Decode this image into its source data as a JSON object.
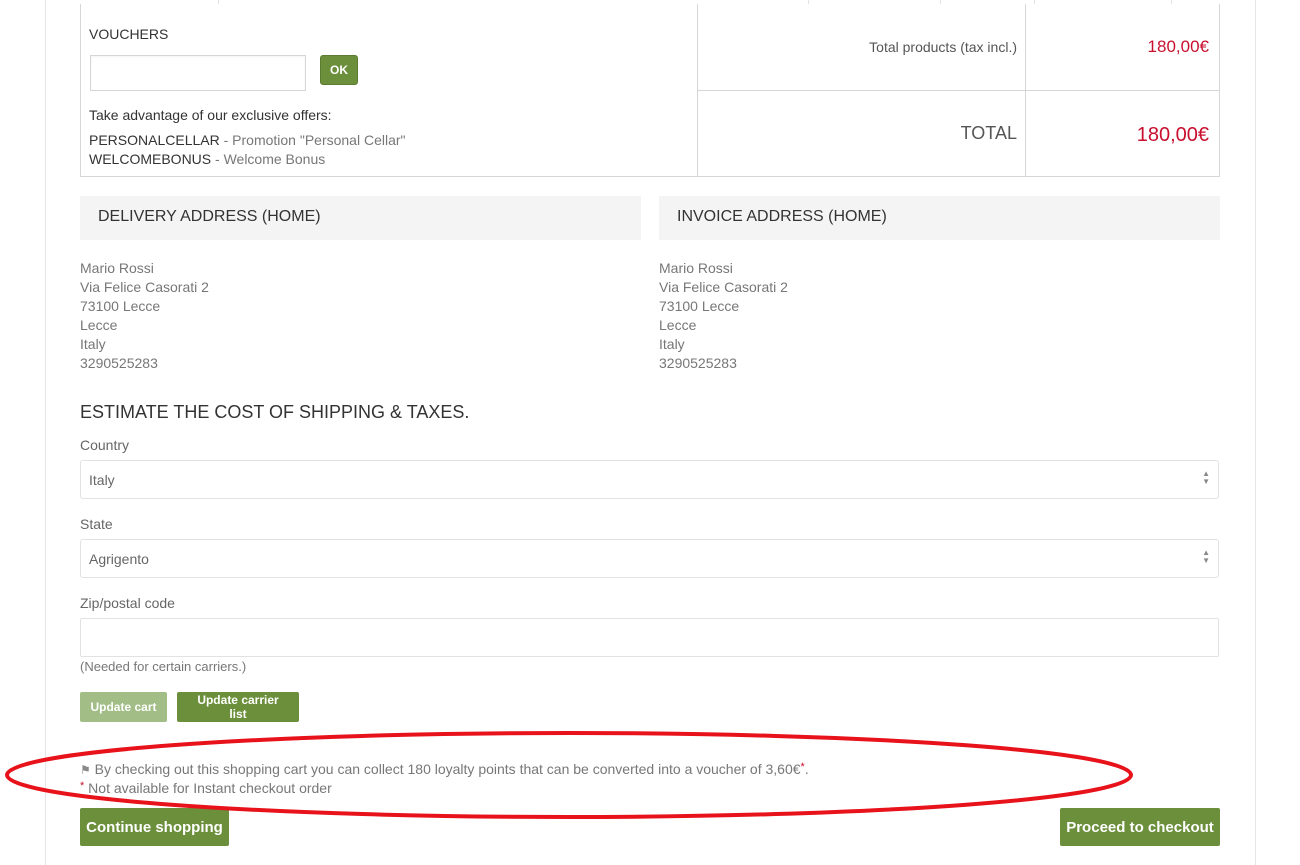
{
  "vouchers": {
    "title": "VOUCHERS",
    "input_value": "",
    "ok_label": "OK",
    "offers_intro": "Take advantage of our exclusive offers:",
    "offers": [
      {
        "code": "PERSONALCELLAR",
        "desc": " - Promotion \"Personal Cellar\""
      },
      {
        "code": "WELCOMEBONUS",
        "desc": " - Welcome Bonus"
      }
    ]
  },
  "totals": {
    "products_label": "Total products (tax incl.)",
    "products_value": "180,00€",
    "total_label": "TOTAL",
    "total_value": "180,00€"
  },
  "delivery": {
    "title": "DELIVERY ADDRESS (HOME)",
    "lines": [
      "Mario Rossi",
      "Via Felice Casorati 2",
      "73100 Lecce",
      "Lecce",
      "Italy",
      "3290525283"
    ]
  },
  "invoice": {
    "title": "INVOICE ADDRESS (HOME)",
    "lines": [
      "Mario Rossi",
      "Via Felice Casorati 2",
      "73100 Lecce",
      "Lecce",
      "Italy",
      "3290525283"
    ]
  },
  "estimate": {
    "title": "ESTIMATE THE COST OF SHIPPING & TAXES.",
    "country_label": "Country",
    "country_value": "Italy",
    "state_label": "State",
    "state_value": "Agrigento",
    "zip_label": "Zip/postal code",
    "zip_value": "",
    "zip_note": "(Needed for certain carriers.)",
    "update_cart_label": "Update cart",
    "update_carrier_label": "Update carrier list"
  },
  "loyalty": {
    "text": "By checking out this shopping cart you can collect 180 loyalty points that can be converted into a voucher of 3,60€",
    "asterisk": "*",
    "period": ".",
    "not_available": "Not available for Instant checkout order"
  },
  "actions": {
    "continue_label": "Continue shopping",
    "proceed_label": "Proceed to checkout"
  },
  "colors": {
    "accent_green": "#6b8f3b",
    "price_red": "#c8102e",
    "annotation_red": "#e8121b"
  },
  "icons": {
    "flag": "flag-icon",
    "select_arrows": "select-arrows-icon"
  }
}
